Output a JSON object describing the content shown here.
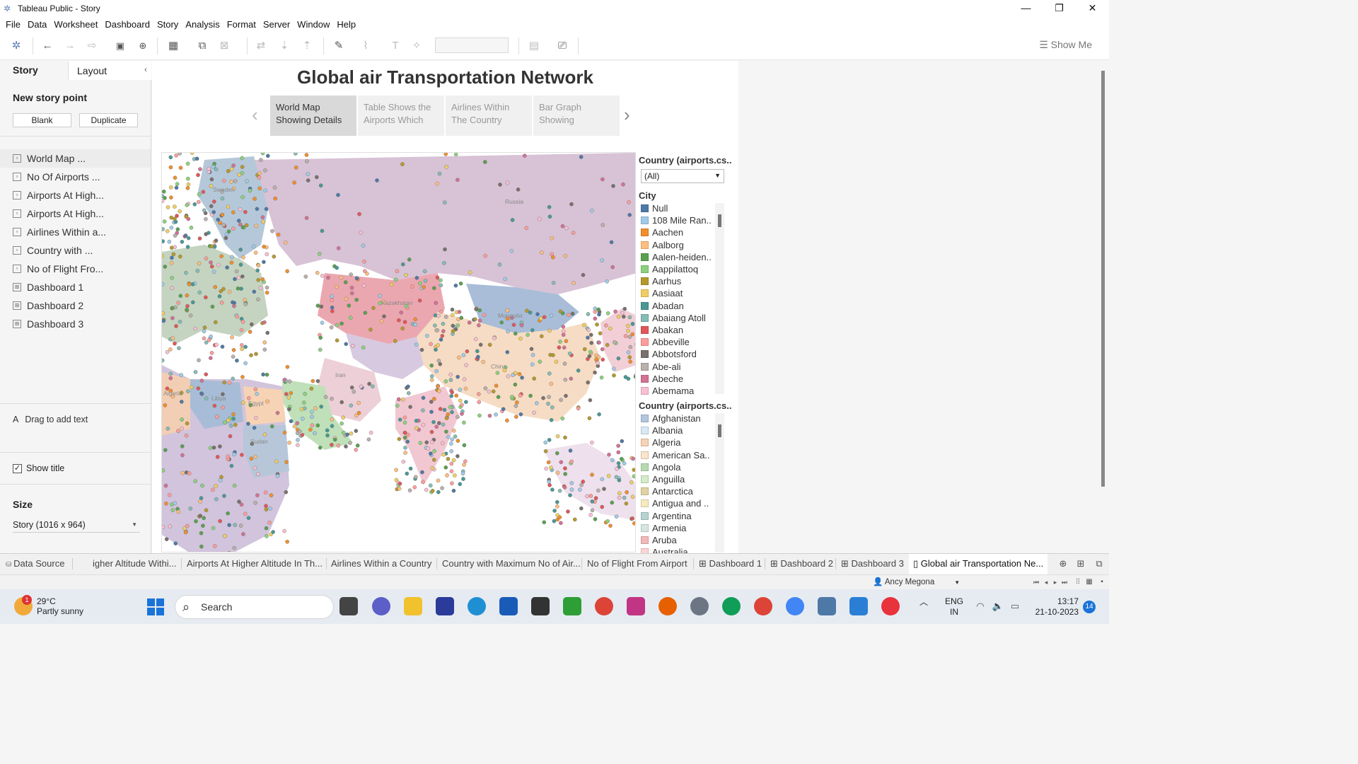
{
  "window": {
    "title": "Tableau Public - Story",
    "min": "—",
    "max": "❐",
    "close": "✕"
  },
  "menu": [
    "File",
    "Data",
    "Worksheet",
    "Dashboard",
    "Story",
    "Analysis",
    "Format",
    "Server",
    "Window",
    "Help"
  ],
  "toolbar": {
    "show_me": "Show Me"
  },
  "leftpane": {
    "tab_story": "Story",
    "tab_layout": "Layout",
    "new_story_point": "New story point",
    "blank_button": "Blank",
    "duplicate_button": "Duplicate",
    "items": [
      {
        "label": "World Map ...",
        "type": "sheet"
      },
      {
        "label": "No Of Airports ...",
        "type": "sheet"
      },
      {
        "label": "Airports At High...",
        "type": "sheet"
      },
      {
        "label": "Airports At High...",
        "type": "sheet"
      },
      {
        "label": "Airlines Within a...",
        "type": "sheet"
      },
      {
        "label": "Country with ...",
        "type": "sheet"
      },
      {
        "label": "No of Flight Fro...",
        "type": "sheet"
      },
      {
        "label": "Dashboard 1",
        "type": "dashboard"
      },
      {
        "label": "Dashboard 2",
        "type": "dashboard"
      },
      {
        "label": "Dashboard 3",
        "type": "dashboard"
      }
    ],
    "drag_text": "Drag to add text",
    "show_title": "Show title",
    "size_label": "Size",
    "size_value": "Story (1016 x 964)"
  },
  "story": {
    "title": "Global air Transportation Network",
    "points": [
      {
        "line1": "World Map",
        "line2": "Showing Details"
      },
      {
        "line1": "Table Shows the",
        "line2": "Airports Which"
      },
      {
        "line1": "Airlines Within",
        "line2": "The Country"
      },
      {
        "line1": "Bar Graph",
        "line2": "Showing"
      }
    ]
  },
  "map": {
    "labels": [
      "Russia",
      "Sweden",
      "Kazakhstan",
      "Mongolia",
      "China",
      "Iran",
      "Egypt",
      "Libya",
      "Sudan",
      "Algeria"
    ]
  },
  "legend": {
    "filter_title": "Country (airports.cs..",
    "filter_value": "(All)",
    "city_title": "City",
    "cities": [
      {
        "name": "Null",
        "color": "#4e79a7"
      },
      {
        "name": "108 Mile Ran..",
        "color": "#a0cbe8"
      },
      {
        "name": "Aachen",
        "color": "#f28e2b"
      },
      {
        "name": "Aalborg",
        "color": "#ffbe7d"
      },
      {
        "name": "Aalen-heiden..",
        "color": "#59a14f"
      },
      {
        "name": "Aappilattoq",
        "color": "#8cd17d"
      },
      {
        "name": "Aarhus",
        "color": "#b6992d"
      },
      {
        "name": "Aasiaat",
        "color": "#f1ce63"
      },
      {
        "name": "Abadan",
        "color": "#499894"
      },
      {
        "name": "Abaiang Atoll",
        "color": "#86bcb6"
      },
      {
        "name": "Abakan",
        "color": "#e15759"
      },
      {
        "name": "Abbeville",
        "color": "#ff9d9a"
      },
      {
        "name": "Abbotsford",
        "color": "#79706e"
      },
      {
        "name": "Abe-ali",
        "color": "#bab0ac"
      },
      {
        "name": "Abeche",
        "color": "#d37295"
      },
      {
        "name": "Abemama",
        "color": "#fabfd2"
      }
    ],
    "country_title": "Country (airports.cs..",
    "countries": [
      {
        "name": "Afghanistan",
        "color": "#b3c6df"
      },
      {
        "name": "Albania",
        "color": "#d9e8f5"
      },
      {
        "name": "Algeria",
        "color": "#f6d3b5"
      },
      {
        "name": "American Sa..",
        "color": "#fbe3cc"
      },
      {
        "name": "Angola",
        "color": "#b7d9b0"
      },
      {
        "name": "Anguilla",
        "color": "#d3ecc9"
      },
      {
        "name": "Antarctica",
        "color": "#e0d3a3"
      },
      {
        "name": "Antigua and ..",
        "color": "#f8eabf"
      },
      {
        "name": "Argentina",
        "color": "#b5d3d1"
      },
      {
        "name": "Armenia",
        "color": "#d4e6e3"
      },
      {
        "name": "Aruba",
        "color": "#f2b9ba"
      },
      {
        "name": "Australia",
        "color": "#fdd5d4"
      }
    ]
  },
  "sheet_tabs": {
    "data_source": "Data Source",
    "tabs": [
      "igher Altitude Withi...",
      "Airports At Higher Altitude In Th...",
      "Airlines Within a Country",
      "Country with Maximum No of Air...",
      "No of Flight From Airport",
      "Dashboard 1",
      "Dashboard 2",
      "Dashboard 3"
    ],
    "active": "Global air Transportation Ne..."
  },
  "status": {
    "user": "Ancy Megona"
  },
  "taskbar": {
    "temp": "29°C",
    "weather": "Partly sunny",
    "weather_badge": "1",
    "search": "Search",
    "lang1": "ENG",
    "lang2": "IN",
    "time": "13:17",
    "date": "21-10-2023",
    "notifications": "14"
  }
}
